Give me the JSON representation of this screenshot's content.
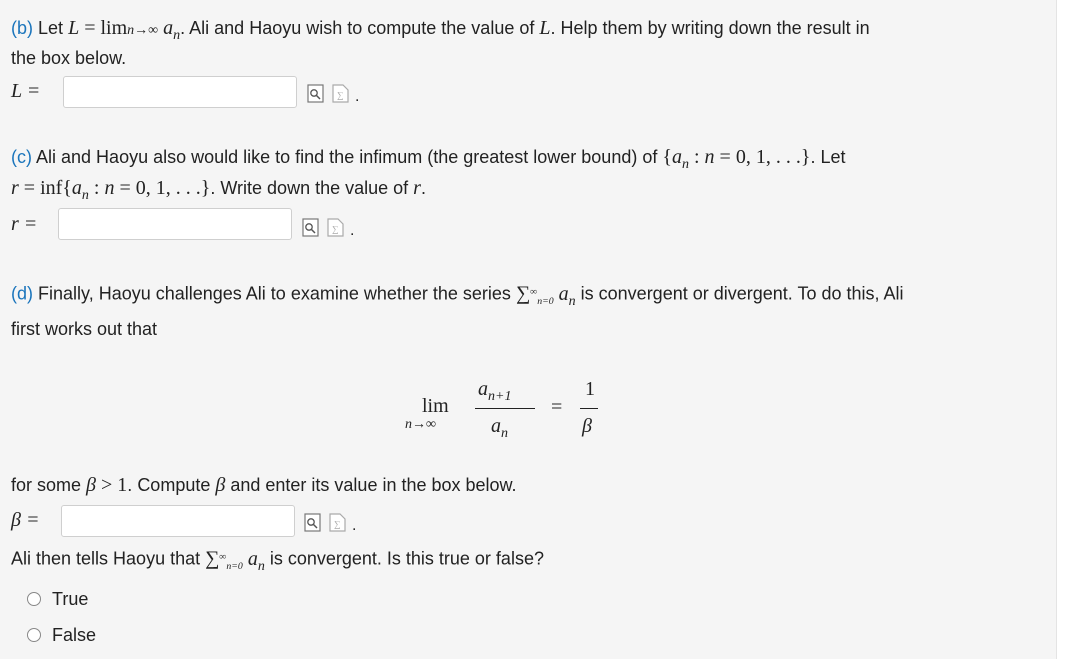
{
  "part_b": {
    "label": "(b)",
    "text_1": "Let",
    "text_2": "Ali and Haoyu wish to compute the value of",
    "text_3": "Help them by writing down the result in",
    "text_4": "the box below.",
    "answer_prefix": "L =",
    "answer_value": ""
  },
  "part_c": {
    "label": "(c)",
    "text_1": "Ali and Haoyu also would like to find the infimum (the greatest lower bound) of",
    "text_2": "Let",
    "text_3": "Write down the value of",
    "answer_prefix": "r =",
    "answer_value": ""
  },
  "part_d": {
    "label": "(d)",
    "text_1": "Finally, Haoyu challenges Ali to examine whether the series",
    "text_2": "is convergent or divergent. To do this, Ali",
    "text_3": "first works out that",
    "text_4": "for some",
    "text_5": "Compute",
    "text_6": "and enter its value in the box below.",
    "answer_prefix": "β =",
    "answer_value": "",
    "text_7": "Ali then tells Haoyu that",
    "text_8": "is convergent. Is this true or false?"
  },
  "options": [
    "True",
    "False"
  ],
  "icons": [
    "preview-icon",
    "formula-icon"
  ]
}
